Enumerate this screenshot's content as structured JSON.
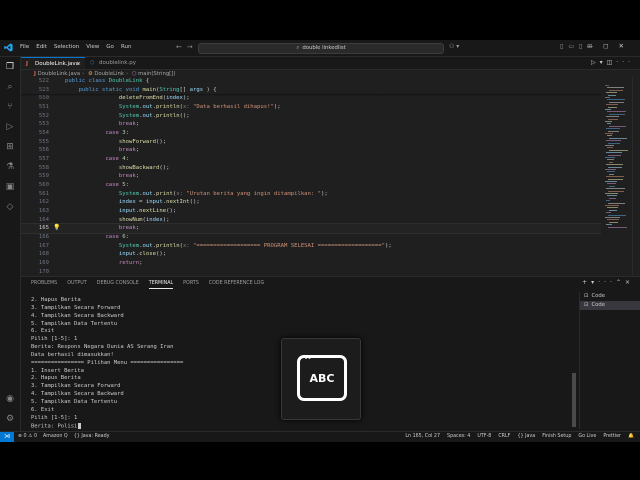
{
  "menu": [
    "File",
    "Edit",
    "Selection",
    "View",
    "Go",
    "Run"
  ],
  "command_center": "double linkedlist",
  "window_controls": [
    "—",
    "◻",
    "✕"
  ],
  "tabs": [
    {
      "label": "DoubleLink.java",
      "icon": "J",
      "active": true
    },
    {
      "label": "doublelink.py",
      "icon": "py",
      "active": false
    }
  ],
  "breadcrumb": [
    "DoubleLink.java",
    "DoubleLink",
    "main(String[])"
  ],
  "editor": {
    "lines": [
      {
        "n": "522",
        "parts": [
          [
            "kw",
            "public "
          ],
          [
            "kw",
            "class "
          ],
          [
            "ty",
            "DoubleLink "
          ],
          [
            "",
            "{"
          ]
        ],
        "ind": 0
      },
      {
        "n": "523",
        "parts": [
          [
            "kw",
            "public "
          ],
          [
            "kw",
            "static "
          ],
          [
            "kw",
            "void "
          ],
          [
            "fn",
            "main"
          ],
          [
            "",
            "("
          ],
          [
            "ty",
            "String"
          ],
          [
            "",
            "[] "
          ],
          [
            "vr",
            "args"
          ],
          [
            "",
            " ) {"
          ]
        ],
        "ind": 4
      },
      {
        "n": "550",
        "parts": [
          [
            "fn",
            "deleteFromEnd"
          ],
          [
            "",
            "("
          ],
          [
            "vr",
            "index"
          ],
          [
            "",
            ");"
          ]
        ],
        "ind": 16
      },
      {
        "n": "551",
        "parts": [
          [
            "ty",
            "System"
          ],
          [
            "",
            "."
          ],
          [
            "vr",
            "out"
          ],
          [
            "",
            "."
          ],
          [
            "fn",
            "println"
          ],
          [
            "",
            "("
          ],
          [
            "hint",
            "x: "
          ],
          [
            "st",
            "\"Data berhasil dihapus!\""
          ],
          [
            "",
            ");"
          ]
        ],
        "ind": 16
      },
      {
        "n": "552",
        "parts": [
          [
            "ty",
            "System"
          ],
          [
            "",
            "."
          ],
          [
            "vr",
            "out"
          ],
          [
            "",
            "."
          ],
          [
            "fn",
            "println"
          ],
          [
            "",
            "();"
          ]
        ],
        "ind": 16
      },
      {
        "n": "553",
        "parts": [
          [
            "ctl",
            "break"
          ],
          [
            "",
            ";"
          ]
        ],
        "ind": 16
      },
      {
        "n": "554",
        "parts": [
          [
            "ctl",
            "case "
          ],
          [
            "nm",
            "3"
          ],
          [
            "",
            ":"
          ]
        ],
        "ind": 12
      },
      {
        "n": "555",
        "parts": [
          [
            "fn",
            "showForward"
          ],
          [
            "",
            "();"
          ]
        ],
        "ind": 16
      },
      {
        "n": "556",
        "parts": [
          [
            "ctl",
            "break"
          ],
          [
            "",
            ";"
          ]
        ],
        "ind": 16
      },
      {
        "n": "557",
        "parts": [
          [
            "ctl",
            "case "
          ],
          [
            "nm",
            "4"
          ],
          [
            "",
            ":"
          ]
        ],
        "ind": 12
      },
      {
        "n": "558",
        "parts": [
          [
            "fn",
            "showBackward"
          ],
          [
            "",
            "();"
          ]
        ],
        "ind": 16
      },
      {
        "n": "559",
        "parts": [
          [
            "ctl",
            "break"
          ],
          [
            "",
            ";"
          ]
        ],
        "ind": 16
      },
      {
        "n": "560",
        "parts": [
          [
            "ctl",
            "case "
          ],
          [
            "nm",
            "5"
          ],
          [
            "",
            ":"
          ]
        ],
        "ind": 12
      },
      {
        "n": "561",
        "parts": [
          [
            "ty",
            "System"
          ],
          [
            "",
            "."
          ],
          [
            "vr",
            "out"
          ],
          [
            "",
            "."
          ],
          [
            "fn",
            "print"
          ],
          [
            "",
            "("
          ],
          [
            "hint",
            "s: "
          ],
          [
            "st",
            "\"Urutan berita yang ingin ditampilkan: \""
          ],
          [
            "",
            ");"
          ]
        ],
        "ind": 16
      },
      {
        "n": "162",
        "parts": [
          [
            "vr",
            "index"
          ],
          [
            "",
            " = "
          ],
          [
            "vr",
            "input"
          ],
          [
            "",
            "."
          ],
          [
            "fn",
            "nextInt"
          ],
          [
            "",
            "();"
          ]
        ],
        "ind": 16
      },
      {
        "n": "163",
        "parts": [
          [
            "vr",
            "input"
          ],
          [
            "",
            "."
          ],
          [
            "fn",
            "nextLine"
          ],
          [
            "",
            "();"
          ]
        ],
        "ind": 16
      },
      {
        "n": "164",
        "parts": [
          [
            "fn",
            "showNum"
          ],
          [
            "",
            "("
          ],
          [
            "vr",
            "index"
          ],
          [
            "",
            ");"
          ]
        ],
        "ind": 16
      },
      {
        "n": "165",
        "parts": [
          [
            "ctl",
            "break"
          ],
          [
            "",
            ";"
          ]
        ],
        "ind": 16,
        "current": true
      },
      {
        "n": "166",
        "parts": [
          [
            "ctl",
            "case "
          ],
          [
            "nm",
            "6"
          ],
          [
            "",
            ":"
          ]
        ],
        "ind": 12
      },
      {
        "n": "167",
        "parts": [
          [
            "ty",
            "System"
          ],
          [
            "",
            "."
          ],
          [
            "vr",
            "out"
          ],
          [
            "",
            "."
          ],
          [
            "fn",
            "println"
          ],
          [
            "",
            "("
          ],
          [
            "hint",
            "x: "
          ],
          [
            "st",
            "\"=================== PROGRAM SELESAI ===================\""
          ],
          [
            "",
            ");"
          ]
        ],
        "ind": 16
      },
      {
        "n": "168",
        "parts": [
          [
            "vr",
            "input"
          ],
          [
            "",
            "."
          ],
          [
            "fn",
            "close"
          ],
          [
            "",
            "();"
          ]
        ],
        "ind": 16
      },
      {
        "n": "169",
        "parts": [
          [
            "ctl",
            "return"
          ],
          [
            "",
            ";"
          ]
        ],
        "ind": 16
      },
      {
        "n": "170",
        "parts": [],
        "ind": 0
      }
    ]
  },
  "panel_tabs": [
    "PROBLEMS",
    "OUTPUT",
    "DEBUG CONSOLE",
    "TERMINAL",
    "PORTS",
    "CODE REFERENCE LOG"
  ],
  "panel_active": "TERMINAL",
  "terminal": {
    "lines": [
      "2. Hapus Berita",
      "3. Tampilkan Secara Forward",
      "4. Tampilkan Secara Backward",
      "5. Tampilkan Data Tertentu",
      "6. Exit",
      "Pilih [1-5]: 1",
      "Berita: Respons Negara Dunia AS Serang Iran",
      "Data berhasil dimasukkan!",
      "================ Pilihan Menu ================",
      "1. Insert Berita",
      "2. Hapus Berita",
      "3. Tampilkan Secara Forward",
      "4. Tampilkan Secara Backward",
      "5. Tampilkan Data Tertentu",
      "6. Exit",
      "Pilih [1-5]: 1",
      "Berita: Polisi"
    ],
    "sessions": [
      "Code",
      "Code"
    ]
  },
  "overlay": {
    "label": "ABC",
    "icon": "text-input-icon"
  },
  "status": {
    "left": [
      "⊗ 0  ⚠ 0",
      "Amazon Q",
      "{} Java: Ready"
    ],
    "right": [
      "Ln 165, Col 27",
      "Spaces: 4",
      "UTF-8",
      "CRLF",
      "{} Java",
      "Finish Setup",
      "Go Live",
      "Prettier"
    ]
  },
  "colors": {
    "accent": "#0078d4",
    "background": "#1f1f1f"
  }
}
